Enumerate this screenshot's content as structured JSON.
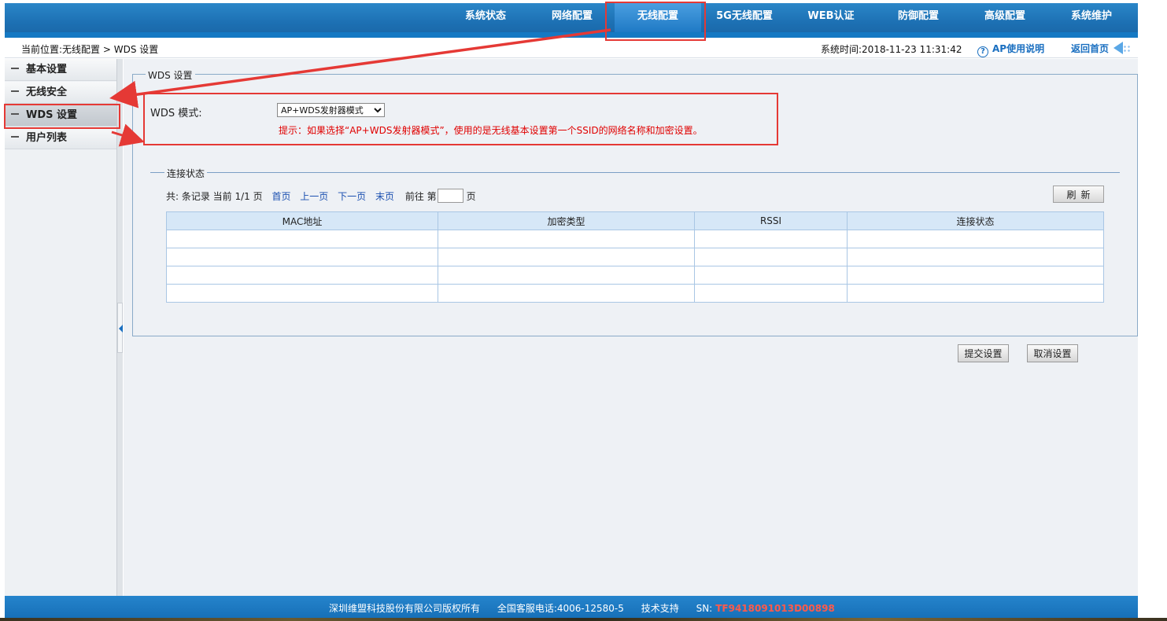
{
  "nav": {
    "items": [
      {
        "label": "系统状态"
      },
      {
        "label": "网络配置"
      },
      {
        "label": "无线配置"
      },
      {
        "label": "5G无线配置"
      },
      {
        "label": "WEB认证"
      },
      {
        "label": "防御配置"
      },
      {
        "label": "高级配置"
      },
      {
        "label": "系统维护"
      }
    ],
    "active_index": 2
  },
  "breadcrumb": {
    "text": "当前位置:无线配置 > WDS 设置",
    "system_time": "系统时间:2018-11-23 11:31:42",
    "help_label": "AP使用说明",
    "home_label": "返回首页"
  },
  "sidebar": {
    "items": [
      {
        "label": "基本设置"
      },
      {
        "label": "无线安全"
      },
      {
        "label": "WDS 设置"
      },
      {
        "label": "用户列表"
      }
    ],
    "active_index": 2
  },
  "wds": {
    "legend": "WDS 设置",
    "mode_label": "WDS 模式:",
    "mode_value": "AP+WDS发射器模式",
    "hint": "提示：如果选择“AP+WDS发射器模式”，使用的是无线基本设置第一个SSID的网络名称和加密设置。"
  },
  "connection": {
    "legend": "连接状态",
    "pager": {
      "summary": "共: 条记录 当前 1/1 页",
      "first": "首页",
      "prev": "上一页",
      "next": "下一页",
      "last": "末页",
      "goto_prefix": "前往 第",
      "goto_suffix": "页"
    },
    "refresh_label": "刷新",
    "columns": [
      "MAC地址",
      "加密类型",
      "RSSI",
      "连接状态"
    ],
    "empty_rows": 4
  },
  "actions": {
    "submit_label": "提交设置",
    "cancel_label": "取消设置"
  },
  "footer": {
    "company": "深圳维盟科技股份有限公司版权所有",
    "hotline": "全国客服电话:4006-12580-5",
    "support": "技术支持",
    "sn_label": "SN:",
    "sn_value": "TF9418091013D00898"
  },
  "colors": {
    "nav_bg": "#1c6fb2",
    "annotation_red": "#e53935",
    "hint_red": "#e00000",
    "link_blue": "#1a4fb0"
  }
}
